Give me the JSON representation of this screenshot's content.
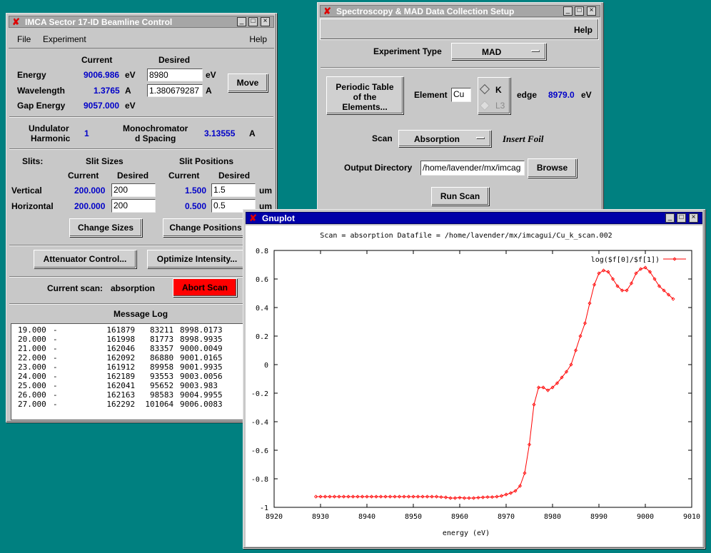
{
  "ctrl": {
    "title": "IMCA Sector 17-ID Beamline Control",
    "menu": {
      "file": "File",
      "experiment": "Experiment",
      "help": "Help"
    },
    "hdr_current": "Current",
    "hdr_desired": "Desired",
    "energy": {
      "label": "Energy",
      "current": "9006.986",
      "unit": "eV",
      "desired": "8980",
      "unit2": "eV"
    },
    "wavelength": {
      "label": "Wavelength",
      "current": "1.3765",
      "unit": "A",
      "desired": "1.380679287",
      "unit2": "A"
    },
    "gap": {
      "label": "Gap Energy",
      "current": "9057.000",
      "unit": "eV"
    },
    "move_label": "Move",
    "undulator": {
      "label1": "Undulator",
      "label2": "Harmonic",
      "value": "1"
    },
    "mono": {
      "label1": "Monochromator",
      "label2": "d Spacing",
      "value": "3.13555",
      "unit": "A"
    },
    "slits": {
      "title": "Slits:",
      "sizes_hdr": "Slit Sizes",
      "positions_hdr": "Slit Positions",
      "current_hdr": "Current",
      "desired_hdr": "Desired",
      "vertical": {
        "label": "Vertical",
        "size_cur": "200.000",
        "size_des": "200",
        "pos_cur": "1.500",
        "pos_des": "1.5",
        "unit": "um"
      },
      "horizontal": {
        "label": "Horizontal",
        "size_cur": "200.000",
        "size_des": "200",
        "pos_cur": "0.500",
        "pos_des": "0.5",
        "unit": "um"
      },
      "change_sizes": "Change Sizes",
      "change_positions": "Change Positions"
    },
    "attenuator": "Attenuator Control...",
    "optimize": "Optimize Intensity...",
    "current_scan_label": "Current scan:",
    "current_scan_value": "absorption",
    "abort": "Abort Scan",
    "abort_color": "#ff0000",
    "log_title": "Message Log",
    "log_rows": [
      [
        "19.000",
        "-",
        "161879",
        "83211",
        "8998.0173"
      ],
      [
        "20.000",
        "-",
        "161998",
        "81773",
        "8998.9935"
      ],
      [
        "21.000",
        "-",
        "162046",
        "83357",
        "9000.0049"
      ],
      [
        "22.000",
        "-",
        "162092",
        "86880",
        "9001.0165"
      ],
      [
        "23.000",
        "-",
        "161912",
        "89958",
        "9001.9935"
      ],
      [
        "24.000",
        "-",
        "162189",
        "93553",
        "9003.0056"
      ],
      [
        "25.000",
        "-",
        "162041",
        "95652",
        "9003.983"
      ],
      [
        "26.000",
        "-",
        "162163",
        "98583",
        "9004.9955"
      ],
      [
        "27.000",
        "-",
        "162292",
        "101064",
        "9006.0083"
      ]
    ]
  },
  "mad": {
    "title": "Spectroscopy & MAD Data Collection Setup",
    "help": "Help",
    "exp_type_label": "Experiment Type",
    "exp_type_value": "MAD",
    "periodic1": "Periodic Table",
    "periodic2": "of the",
    "periodic3": "Elements...",
    "element_label": "Element",
    "element_value": "Cu",
    "edge_k": "K",
    "edge_l3": "L3",
    "edge_label": "edge",
    "edge_value": "8979.0",
    "edge_unit": "eV",
    "scan_label": "Scan",
    "scan_value": "Absorption",
    "insert_foil": "Insert Foil",
    "outdir_label": "Output Directory",
    "outdir_value": "/home/lavender/mx/imcag",
    "browse": "Browse",
    "run_scan": "Run Scan"
  },
  "gnuplot": {
    "title": "Gnuplot",
    "header": "Scan = absorption  Datafile = /home/lavender/mx/imcagui/Cu_k_scan.002",
    "line_color": "#ff0000"
  },
  "window_buttons": {
    "min": "_",
    "max": "□",
    "close": "×"
  },
  "chart_data": {
    "type": "line",
    "title": "Scan = absorption  Datafile = /home/lavender/mx/imcagui/Cu_k_scan.002",
    "xlabel": "energy (eV)",
    "ylabel": "",
    "xlim": [
      8920,
      9010
    ],
    "ylim": [
      -1,
      0.8
    ],
    "xticks": [
      "8920",
      "8930",
      "8940",
      "8950",
      "8960",
      "8970",
      "8980",
      "8990",
      "9000",
      "9010"
    ],
    "yticks": [
      "-1",
      "-0.8",
      "-0.6",
      "-0.4",
      "-0.2",
      "0",
      "0.2",
      "0.4",
      "0.6",
      "0.8"
    ],
    "legend_position": "top-right",
    "series": [
      {
        "name": "log($f[0]/$f[1])",
        "x": [
          8929,
          8930,
          8931,
          8932,
          8933,
          8934,
          8935,
          8936,
          8937,
          8938,
          8939,
          8940,
          8941,
          8942,
          8943,
          8944,
          8945,
          8946,
          8947,
          8948,
          8949,
          8950,
          8951,
          8952,
          8953,
          8954,
          8955,
          8956,
          8957,
          8958,
          8959,
          8960,
          8961,
          8962,
          8963,
          8964,
          8965,
          8966,
          8967,
          8968,
          8969,
          8970,
          8971,
          8972,
          8973,
          8974,
          8975,
          8976,
          8977,
          8978,
          8979,
          8980,
          8981,
          8982,
          8983,
          8984,
          8985,
          8986,
          8987,
          8988,
          8989,
          8990,
          8991,
          8992,
          8993,
          8994,
          8995,
          8996,
          8997,
          8998,
          8999,
          9000,
          9001,
          9002,
          9003,
          9004,
          9005,
          9006
        ],
        "y": [
          -0.925,
          -0.925,
          -0.925,
          -0.925,
          -0.925,
          -0.925,
          -0.925,
          -0.925,
          -0.925,
          -0.925,
          -0.925,
          -0.925,
          -0.925,
          -0.925,
          -0.925,
          -0.925,
          -0.925,
          -0.925,
          -0.925,
          -0.925,
          -0.925,
          -0.925,
          -0.925,
          -0.925,
          -0.925,
          -0.925,
          -0.925,
          -0.928,
          -0.93,
          -0.935,
          -0.935,
          -0.932,
          -0.935,
          -0.935,
          -0.935,
          -0.932,
          -0.93,
          -0.928,
          -0.928,
          -0.925,
          -0.92,
          -0.91,
          -0.9,
          -0.885,
          -0.85,
          -0.76,
          -0.56,
          -0.28,
          -0.16,
          -0.16,
          -0.18,
          -0.16,
          -0.13,
          -0.09,
          -0.05,
          0.0,
          0.1,
          0.2,
          0.29,
          0.43,
          0.56,
          0.64,
          0.66,
          0.65,
          0.6,
          0.55,
          0.52,
          0.52,
          0.57,
          0.64,
          0.67,
          0.68,
          0.65,
          0.6,
          0.55,
          0.52,
          0.49,
          0.46
        ]
      }
    ]
  }
}
